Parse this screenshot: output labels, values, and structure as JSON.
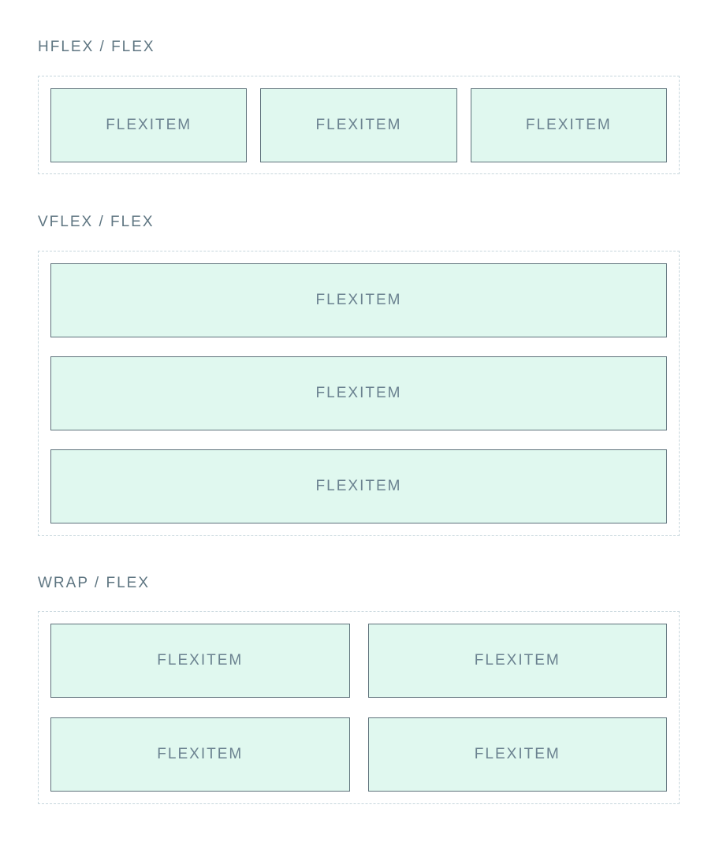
{
  "sections": [
    {
      "label": "HFLEX / FLEX",
      "items": [
        "FLEXITEM",
        "FLEXITEM",
        "FLEXITEM"
      ]
    },
    {
      "label": "VFLEX / FLEX",
      "items": [
        "FLEXITEM",
        "FLEXITEM",
        "FLEXITEM"
      ]
    },
    {
      "label": "WRAP / FLEX",
      "items": [
        "FLEXITEM",
        "FLEXITEM",
        "FLEXITEM",
        "FLEXITEM"
      ]
    }
  ],
  "colors": {
    "item_fill": "#e0f8ef",
    "item_border": "#5e727b",
    "text": "#5f7682",
    "dashed_border": "#c6d6dc"
  }
}
